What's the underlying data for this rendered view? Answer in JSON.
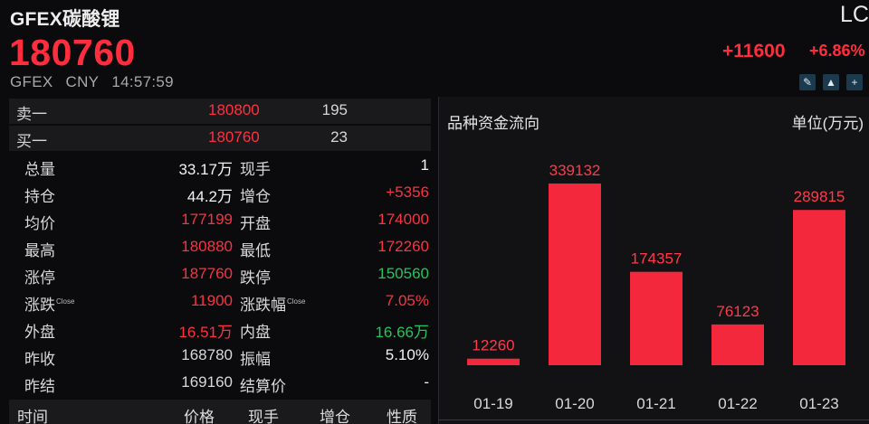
{
  "header": {
    "title": "GFEX碳酸锂",
    "code": "LC",
    "price": "180760",
    "change": "+11600",
    "change_pct": "+6.86%",
    "exchange": "GFEX",
    "currency": "CNY",
    "time": "14:57:59",
    "tools": [
      "edit-icon",
      "bell-icon",
      "add-icon"
    ]
  },
  "orderbook": [
    {
      "label": "卖一",
      "price": "180800",
      "volume": "195"
    },
    {
      "label": "买一",
      "price": "180760",
      "volume": "23"
    }
  ],
  "stats": [
    {
      "l1": "总量",
      "v1": "33.17万",
      "c1": "#f2f2f2",
      "l2": "现手",
      "sup2": "",
      "v2": "1",
      "c2": "#f2f2f2",
      "sup1": ""
    },
    {
      "l1": "持仓",
      "v1": "44.2万",
      "c1": "#f2f2f2",
      "l2": "增仓",
      "sup2": "",
      "v2": "+5356",
      "c2": "#ff3040",
      "sup1": ""
    },
    {
      "l1": "均价",
      "v1": "177199",
      "c1": "#ff3040",
      "l2": "开盘",
      "sup2": "",
      "v2": "174000",
      "c2": "#ff3040",
      "sup1": ""
    },
    {
      "l1": "最高",
      "v1": "180880",
      "c1": "#ff3040",
      "l2": "最低",
      "sup2": "",
      "v2": "172260",
      "c2": "#ff3040",
      "sup1": ""
    },
    {
      "l1": "涨停",
      "v1": "187760",
      "c1": "#ff3040",
      "l2": "跌停",
      "sup2": "",
      "v2": "150560",
      "c2": "#22c55e",
      "sup1": ""
    },
    {
      "l1": "涨跌",
      "sup1": "Close",
      "v1": "11900",
      "c1": "#ff3040",
      "l2": "涨跌幅",
      "sup2": "Close",
      "v2": "7.05%",
      "c2": "#ff3040"
    },
    {
      "l1": "外盘",
      "v1": "16.51万",
      "c1": "#ff3040",
      "l2": "内盘",
      "sup2": "",
      "v2": "16.66万",
      "c2": "#22c55e",
      "sup1": ""
    },
    {
      "l1": "昨收",
      "v1": "168780",
      "c1": "#d8d8d8",
      "l2": "振幅",
      "sup2": "",
      "v2": "5.10%",
      "c2": "#f2f2f2",
      "sup1": ""
    },
    {
      "l1": "昨结",
      "v1": "169160",
      "c1": "#d8d8d8",
      "l2": "结算价",
      "sup2": "",
      "v2": "-",
      "c2": "#f2f2f2",
      "sup1": ""
    }
  ],
  "trade_table": {
    "headers": [
      "时间",
      "价格",
      "现手",
      "增仓",
      "性质"
    ]
  },
  "fund_flow": {
    "title": "品种资金流向",
    "unit": "单位(万元)"
  },
  "chart_data": {
    "type": "bar",
    "title": "品种资金流向",
    "xlabel": "",
    "ylabel": "单位(万元)",
    "categories": [
      "01-19",
      "01-20",
      "01-21",
      "01-22",
      "01-23"
    ],
    "values": [
      12260,
      339132,
      174357,
      76123,
      289815
    ],
    "color": "#f3283c",
    "ylim": [
      0,
      339132
    ],
    "grid": false,
    "data_labels": true
  }
}
